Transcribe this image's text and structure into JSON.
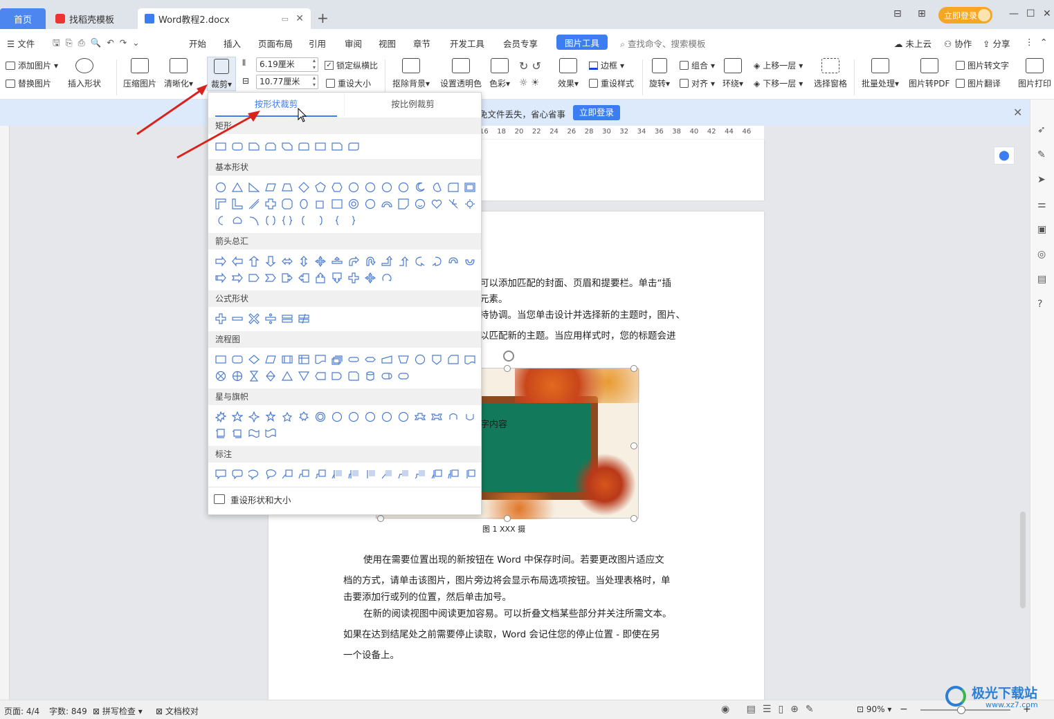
{
  "tabs": {
    "home": "首页",
    "templates": "找稻壳模板",
    "doc": "Word教程2.docx",
    "add": "+"
  },
  "account": {
    "login": "立即登录"
  },
  "menubar": {
    "file": "文件",
    "items": [
      "开始",
      "插入",
      "页面布局",
      "引用",
      "审阅",
      "视图",
      "章节",
      "开发工具",
      "会员专享"
    ],
    "active": "图片工具",
    "search": "查找命令、搜索模板",
    "cloud": "未上云",
    "collab": "协作",
    "share": "分享"
  },
  "ribbon": {
    "add_pic": "添加图片",
    "replace_pic": "替换图片",
    "insert_shape": "插入形状",
    "compress": "压缩图片",
    "sharpen": "清晰化",
    "crop": "裁剪",
    "width": "6.19厘米",
    "height": "10.77厘米",
    "lock_ratio": "锁定纵横比",
    "reset_size": "重设大小",
    "remove_bg": "抠除背景",
    "set_transparent": "设置透明色",
    "color": "色彩",
    "effects": "效果",
    "border": "边框",
    "reset_style": "重设样式",
    "rotate": "旋转",
    "group": "组合",
    "align": "对齐",
    "wrap": "环绕",
    "bring_forward": "上移一层",
    "send_backward": "下移一层",
    "select_pane": "选择窗格",
    "batch": "批量处理",
    "to_pdf": "图片转PDF",
    "to_text": "图片转文字",
    "translate": "图片翻译",
    "print": "图片打印"
  },
  "banner": {
    "text": "免文件丢失，省心省事",
    "button": "立即登录"
  },
  "ruler": {
    "ticks": [
      "16",
      "18",
      "20",
      "22",
      "24",
      "26",
      "28",
      "30",
      "32",
      "34",
      "36",
      "38",
      "40",
      "42",
      "44",
      "46"
    ]
  },
  "crop_menu": {
    "tab_shape": "按形状裁剪",
    "tab_ratio": "按比例裁剪",
    "sections": [
      "矩形",
      "基本形状",
      "箭头总汇",
      "公式形状",
      "流程图",
      "星与旗帜",
      "标注"
    ],
    "reset": "重设形状和大小"
  },
  "document": {
    "lines_top": [
      "可以添加匹配的封面、页眉和提要栏。单击“插",
      "元素。",
      "持协调。当您单击设计并选择新的主题时，图片、",
      "以匹配新的主题。当应用样式时，您的标题会进"
    ],
    "image_text": "字内容",
    "caption": "图 1   XXX 摄",
    "body": [
      "使用在需要位置出现的新按钮在 Word 中保存时间。若要更改图片适应文",
      "档的方式，请单击该图片，图片旁边将会显示布局选项按钮。当处理表格时，单",
      "击要添加行或列的位置，然后单击加号。",
      "在新的阅读视图中阅读更加容易。可以折叠文档某些部分并关注所需文本。",
      "如果在达到结尾处之前需要停止读取，Word 会记住您的停止位置 - 即使在另",
      "一个设备上。"
    ]
  },
  "status": {
    "page": "页面: 4/4",
    "words": "字数: 849",
    "spell": "拼写检查",
    "proof": "文档校对",
    "zoom": "90%"
  },
  "watermark": {
    "brand": "极光下载站",
    "url": "www.xz7.com"
  }
}
